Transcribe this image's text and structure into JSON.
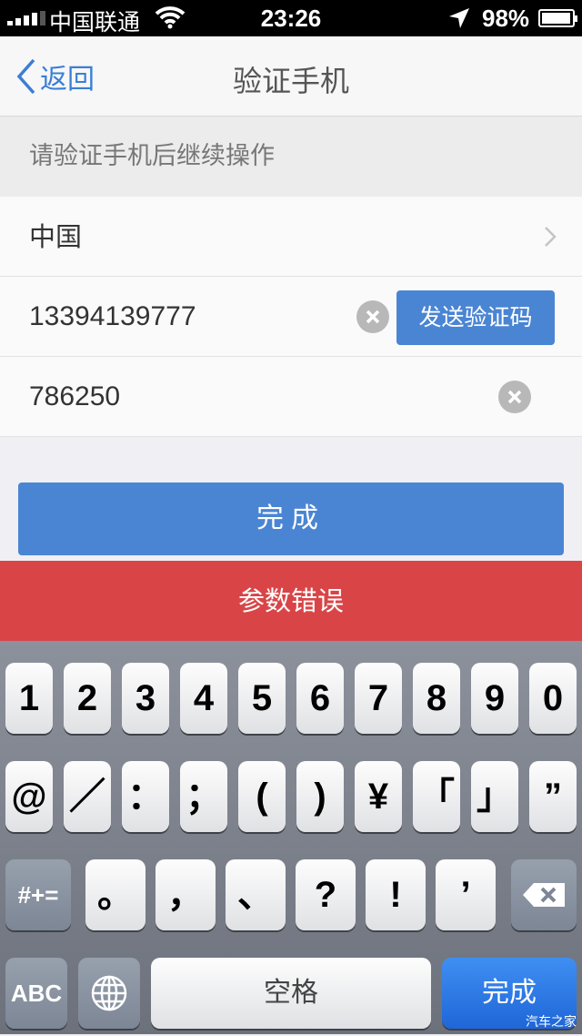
{
  "status_bar": {
    "carrier": "中国联通",
    "time": "23:26",
    "battery": "98%",
    "battery_level": 0.98
  },
  "nav": {
    "back_label": "返回",
    "title": "验证手机"
  },
  "hint": "请验证手机后继续操作",
  "form": {
    "country": "中国",
    "phone": "13394139777",
    "send_code_label": "发送验证码",
    "code": "786250"
  },
  "done_label": "完成",
  "error": "参数错误",
  "keyboard": {
    "row1": [
      "1",
      "2",
      "3",
      "4",
      "5",
      "6",
      "7",
      "8",
      "9",
      "0"
    ],
    "row2": [
      "@",
      "／",
      "：",
      "；",
      "(",
      ")",
      "¥",
      "「",
      "」",
      "”"
    ],
    "row3_mode": "#+=",
    "row3": [
      "。",
      "，",
      "、",
      "?",
      "!",
      "’"
    ],
    "abc": "ABC",
    "space": "空格",
    "done": "完成"
  },
  "watermark": "汽车之家",
  "colors": {
    "accent": "#4a85d3",
    "error": "#d94547"
  }
}
